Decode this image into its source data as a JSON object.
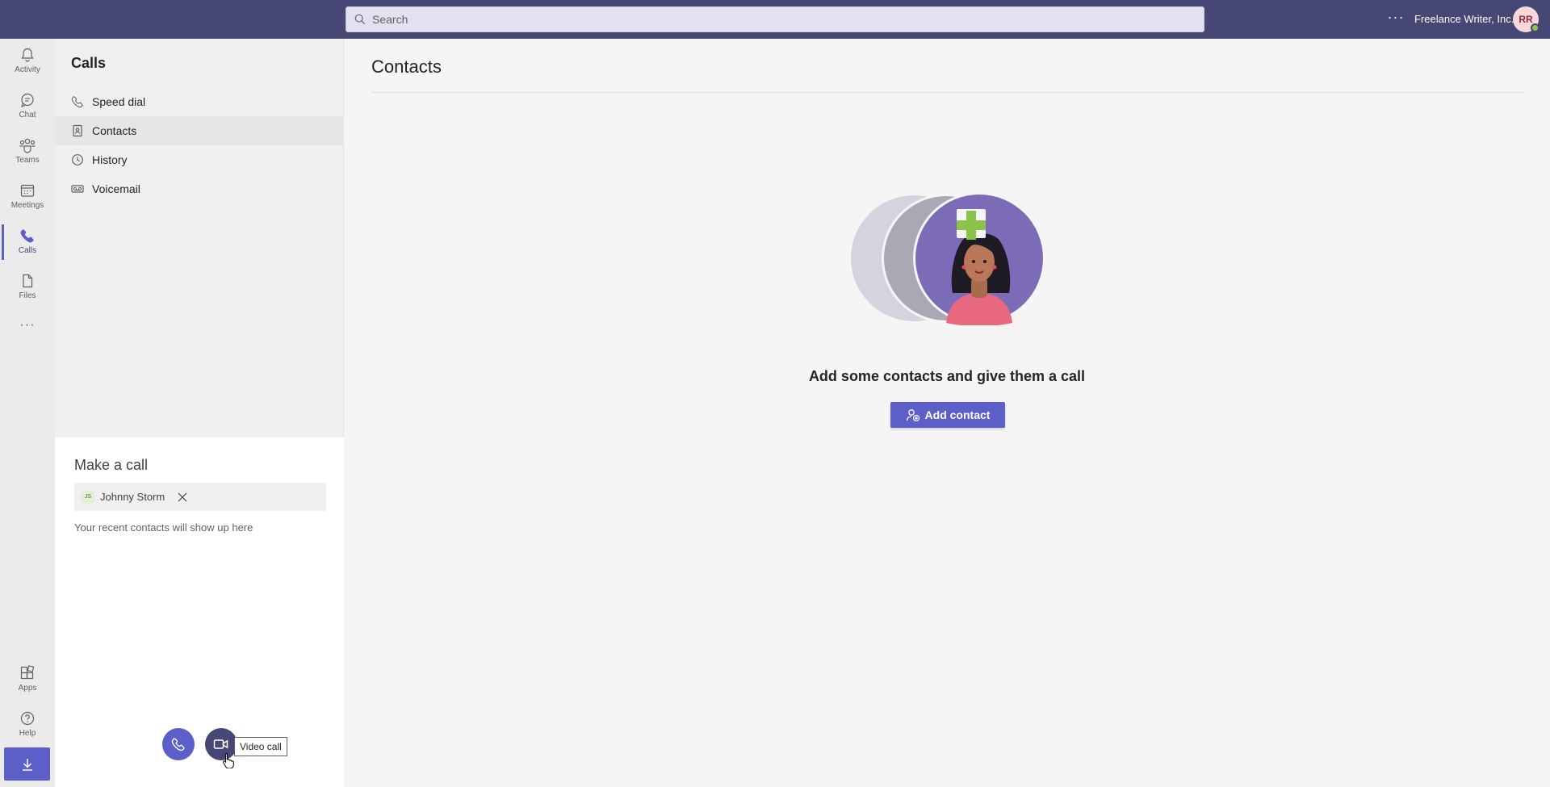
{
  "topbar": {
    "search_placeholder": "Search",
    "org_name": "Freelance Writer, Inc.",
    "avatar_initials": "RR",
    "more_label": "···"
  },
  "rail": {
    "items": [
      {
        "label": "Activity",
        "icon": "bell-icon"
      },
      {
        "label": "Chat",
        "icon": "chat-icon"
      },
      {
        "label": "Teams",
        "icon": "teams-icon"
      },
      {
        "label": "Meetings",
        "icon": "calendar-icon"
      },
      {
        "label": "Calls",
        "icon": "phone-icon",
        "active": true
      },
      {
        "label": "Files",
        "icon": "file-icon"
      }
    ],
    "more_label": "···",
    "apps_label": "Apps",
    "help_label": "Help"
  },
  "panel": {
    "title": "Calls",
    "nav": [
      {
        "label": "Speed dial",
        "icon": "phone-icon"
      },
      {
        "label": "Contacts",
        "icon": "contact-card-icon",
        "selected": true
      },
      {
        "label": "History",
        "icon": "clock-icon"
      },
      {
        "label": "Voicemail",
        "icon": "voicemail-icon"
      }
    ],
    "make_call": {
      "title": "Make a call",
      "recipient_initials": "JS",
      "recipient_name": "Johnny Storm",
      "recent_hint": "Your recent contacts will show up here",
      "tooltip": "Video call"
    }
  },
  "main": {
    "title": "Contacts",
    "empty_message": "Add some contacts and give them a call",
    "add_contact_label": "Add contact"
  },
  "colors": {
    "header": "#464775",
    "accent": "#5b5fc7",
    "presence": "#92c353"
  }
}
